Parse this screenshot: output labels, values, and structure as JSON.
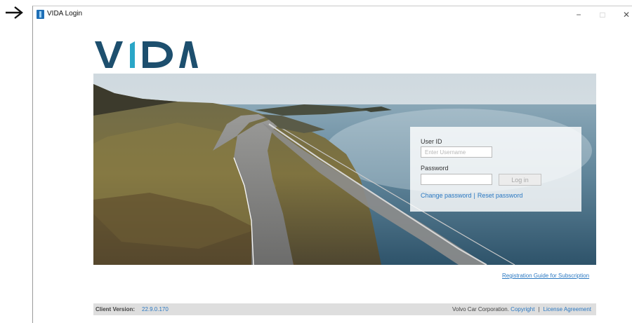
{
  "window": {
    "title": "VIDA Login",
    "controls": {
      "minimize": "−",
      "maximize": "□",
      "close": "✕"
    }
  },
  "brand": {
    "logo_text": "VIDA",
    "logo_color": "#1d4f6e",
    "accent_color": "#2aa6c7"
  },
  "login": {
    "user_label": "User ID",
    "user_placeholder": "Enter Username",
    "user_value": "",
    "password_label": "Password",
    "password_value": "",
    "login_button": "Log in",
    "change_password": "Change password",
    "separator": "|",
    "reset_password": "Reset password"
  },
  "registration_link": "Registration Guide for Subscription",
  "footer": {
    "version_label": "Client Version:",
    "version_value": "22.9.0.170",
    "company": "Volvo Car Corporation.",
    "copyright": "Copyright",
    "separator": "|",
    "license": "License Agreement"
  },
  "colors": {
    "link": "#2a78c2",
    "footer_bg": "#dedede"
  }
}
